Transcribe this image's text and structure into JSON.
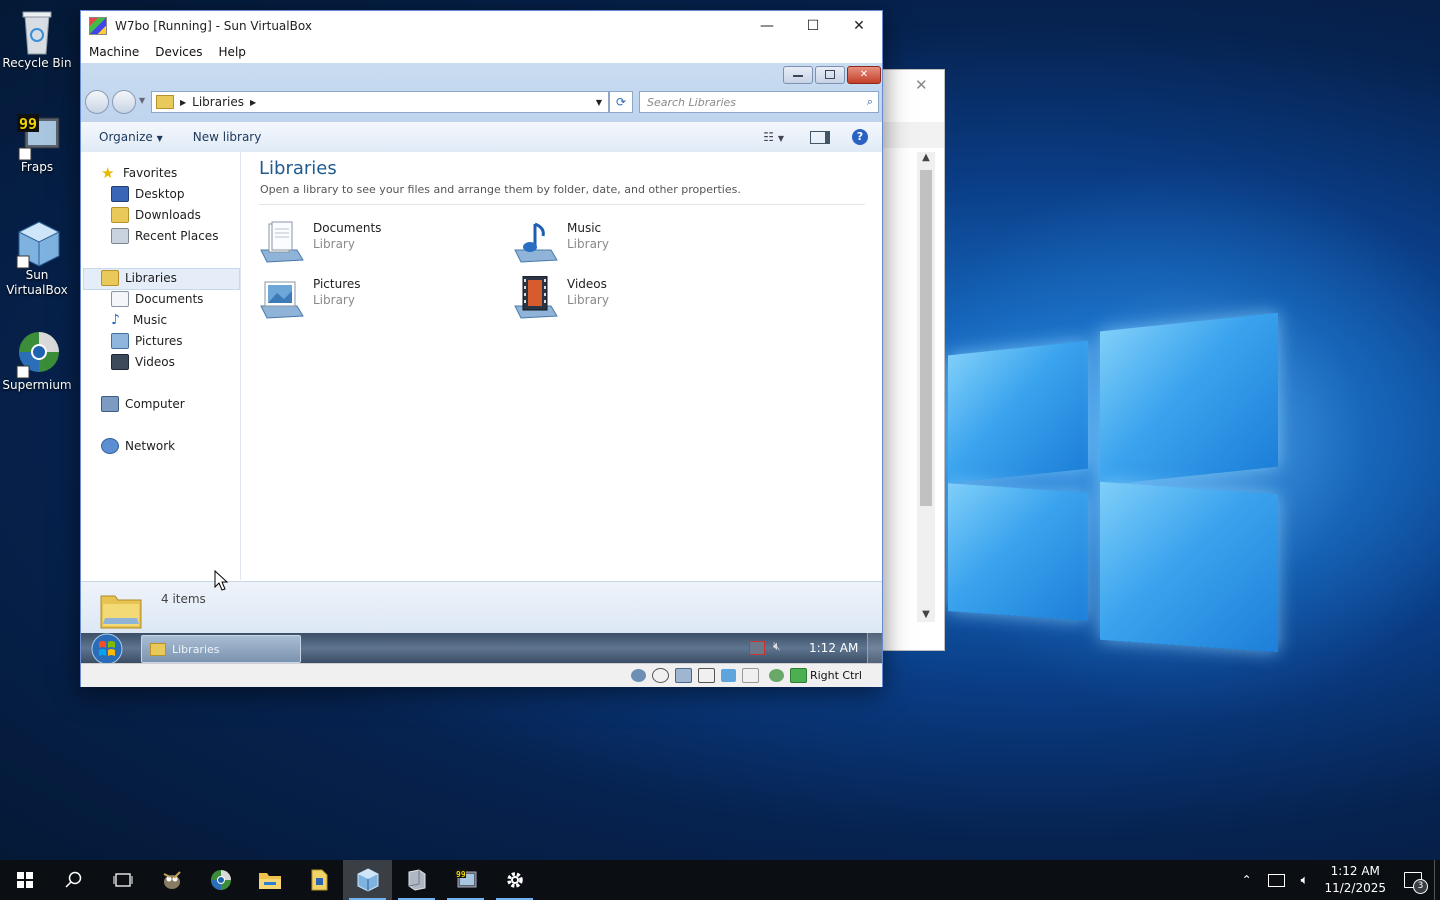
{
  "desktop": {
    "icons": [
      {
        "label": "Recycle Bin"
      },
      {
        "label": "Fraps"
      },
      {
        "label": "Sun VirtualBox"
      },
      {
        "label": "Supermium"
      }
    ]
  },
  "vbox": {
    "title": "W7bo [Running] - Sun VirtualBox",
    "menu": [
      "Machine",
      "Devices",
      "Help"
    ],
    "status_host_key": "Right Ctrl"
  },
  "explorer": {
    "breadcrumb": "Libraries",
    "search_placeholder": "Search Libraries",
    "organize": "Organize",
    "new_library": "New library",
    "nav": {
      "favorites": "Favorites",
      "desktop": "Desktop",
      "downloads": "Downloads",
      "recent": "Recent Places",
      "libraries": "Libraries",
      "documents": "Documents",
      "music": "Music",
      "pictures": "Pictures",
      "videos": "Videos",
      "computer": "Computer",
      "network": "Network"
    },
    "heading": "Libraries",
    "subtitle": "Open a library to see your files and arrange them by folder, date, and other properties.",
    "libraries": [
      {
        "name": "Documents",
        "type": "Library"
      },
      {
        "name": "Music",
        "type": "Library"
      },
      {
        "name": "Pictures",
        "type": "Library"
      },
      {
        "name": "Videos",
        "type": "Library"
      }
    ],
    "details": "4 items"
  },
  "guest_taskbar": {
    "task": "Libraries",
    "time": "1:12 AM"
  },
  "host_taskbar": {
    "time": "1:12 AM",
    "date": "11/2/2025",
    "notifications": "3"
  }
}
